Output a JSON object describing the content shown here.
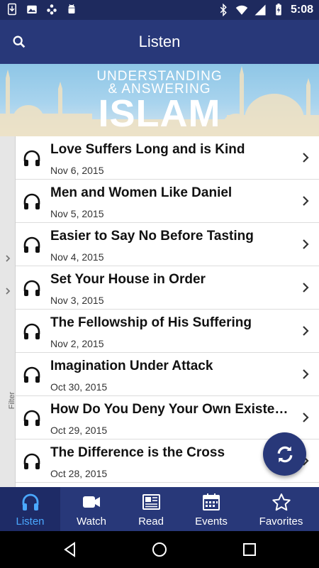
{
  "status_bar": {
    "time": "5:08",
    "left_icons": [
      "download-icon",
      "photo-icon",
      "gamepad-icon",
      "android-icon"
    ],
    "right_icons": [
      "bluetooth-icon",
      "wifi-icon",
      "cellular-icon",
      "battery-icon"
    ]
  },
  "app_bar": {
    "title": "Listen",
    "search_icon": "search-icon"
  },
  "banner": {
    "line1": "UNDERSTANDING",
    "line2": "& ANSWERING",
    "line3": "ISLAM"
  },
  "filter": {
    "label": "Filter",
    "icon": "chevron-right-icon"
  },
  "episodes": [
    {
      "title": "Love Suffers Long and is Kind",
      "date": "Nov 6, 2015"
    },
    {
      "title": "Men and Women Like Daniel",
      "date": "Nov 5, 2015"
    },
    {
      "title": "Easier to Say No Before Tasting",
      "date": "Nov 4, 2015"
    },
    {
      "title": "Set Your House in Order",
      "date": "Nov 3, 2015"
    },
    {
      "title": "The Fellowship of His Suffering",
      "date": "Nov 2, 2015"
    },
    {
      "title": "Imagination Under Attack",
      "date": "Oct 30, 2015"
    },
    {
      "title": "How Do You Deny Your Own Existen…",
      "date": "Oct 29, 2015"
    },
    {
      "title": "The Difference is the Cross",
      "date": "Oct 28, 2015"
    }
  ],
  "fab": {
    "icon": "refresh-icon"
  },
  "tabs": [
    {
      "label": "Listen",
      "icon": "headphones-icon",
      "active": true
    },
    {
      "label": "Watch",
      "icon": "video-camera-icon",
      "active": false
    },
    {
      "label": "Read",
      "icon": "newspaper-icon",
      "active": false
    },
    {
      "label": "Events",
      "icon": "calendar-icon",
      "active": false
    },
    {
      "label": "Favorites",
      "icon": "star-icon",
      "active": false
    }
  ],
  "colors": {
    "app_bar": "#283879",
    "status_bar": "#1e2a5e",
    "active_tab": "#4aa8ff",
    "fab": "#283879"
  }
}
